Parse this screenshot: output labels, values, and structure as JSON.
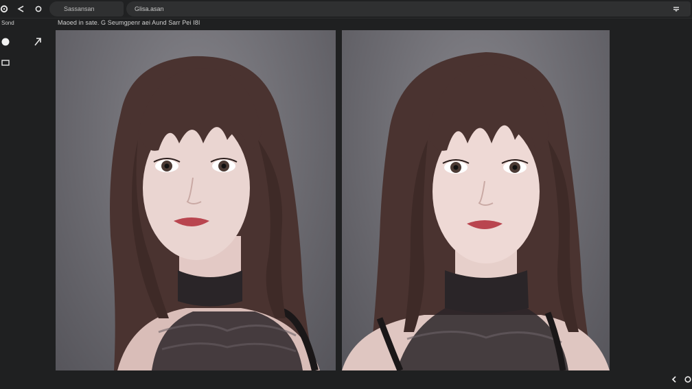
{
  "toolbar": {
    "tab_label": "Sassansan",
    "address_text": "Glisa.asan",
    "icons": [
      "settings-icon",
      "share-icon",
      "refresh-icon",
      "menu-icon"
    ]
  },
  "subbar": {
    "left_label": "Sond",
    "caption": "Maoed in sate. G Seumgpenr aei Aund Sarr Pei I8I"
  },
  "tools": [
    "circle-tool-icon",
    "arrow-tool-icon",
    "rectangle-tool-icon"
  ],
  "panels": [
    {
      "name": "image-left",
      "description": "portrait image 1"
    },
    {
      "name": "image-right",
      "description": "portrait image 2"
    }
  ],
  "colors": {
    "background": "#1f2021",
    "toolbar_field": "#2f3031",
    "panel_bg": "#6d6c72",
    "hair": "#4a3330",
    "skin": "#e8d2ce",
    "lace": "#2a2528"
  }
}
